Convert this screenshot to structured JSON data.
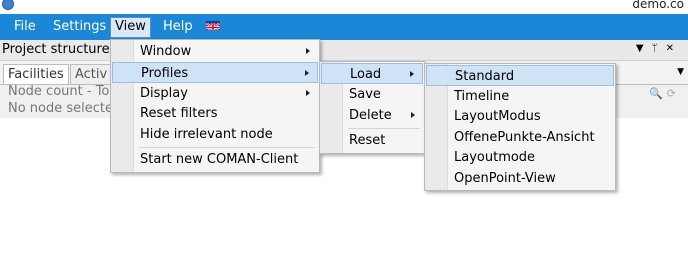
{
  "app": {
    "title": "demo.co"
  },
  "menubar": {
    "items": [
      {
        "label": "File"
      },
      {
        "label": "Settings"
      },
      {
        "label": "View"
      },
      {
        "label": "Help"
      }
    ]
  },
  "panel": {
    "title": "Project structure",
    "tabs": [
      {
        "label": "Facilities"
      },
      {
        "label": "Activ"
      }
    ],
    "node_count": "Node count - To",
    "no_selection": "No node selected"
  },
  "view_menu": {
    "items": [
      {
        "label": "Window"
      },
      {
        "label": "Profiles"
      },
      {
        "label": "Display"
      },
      {
        "label": "Reset filters"
      },
      {
        "label": "Hide irrelevant node"
      },
      {
        "label": "Start new COMAN-Client"
      }
    ]
  },
  "profiles_menu": {
    "items": [
      {
        "label": "Load"
      },
      {
        "label": "Save"
      },
      {
        "label": "Delete"
      },
      {
        "label": "Reset"
      }
    ]
  },
  "load_menu": {
    "items": [
      {
        "label": "Standard"
      },
      {
        "label": "Timeline"
      },
      {
        "label": "LayoutModus"
      },
      {
        "label": "OffenePunkte-Ansicht"
      },
      {
        "label": "Layoutmode"
      },
      {
        "label": "OpenPoint-View"
      }
    ]
  },
  "colors": {
    "menubar": "#1c87d6",
    "highlight": "#cfe3f7"
  },
  "icons": [
    "app-logo-icon",
    "flag-uk-icon",
    "submenu-arrow-icon",
    "pin-icon",
    "close-icon",
    "search-icon",
    "refresh-icon"
  ]
}
